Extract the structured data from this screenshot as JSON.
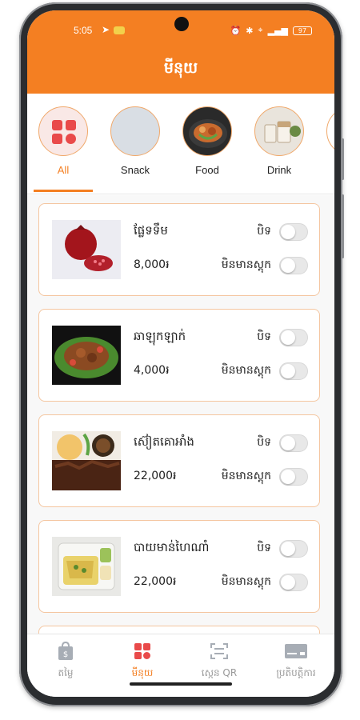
{
  "status": {
    "time": "5:05",
    "battery": "97"
  },
  "header": {
    "title": "មីនុយ"
  },
  "categories": [
    {
      "label": "All",
      "icon": "grid-icon"
    },
    {
      "label": "Snack",
      "icon": "snack-image"
    },
    {
      "label": "Food",
      "icon": "food-image"
    },
    {
      "label": "Drink",
      "icon": "drink-image"
    }
  ],
  "items": [
    {
      "name": "ផ្លែទទឹម",
      "price": "8,000៛",
      "close_label": "បិទ",
      "stock_label": "មិនមានស្តុក"
    },
    {
      "name": "ឆាឡុកឡាក់",
      "price": "4,000៛",
      "close_label": "បិទ",
      "stock_label": "មិនមានស្តុក"
    },
    {
      "name": "ស៊ៀតគោអាំង",
      "price": "22,000៛",
      "close_label": "បិទ",
      "stock_label": "មិនមានស្តុក"
    },
    {
      "name": "បាយមាន់ហៃណាំ",
      "price": "22,000៛",
      "close_label": "បិទ",
      "stock_label": "មិនមានស្តុក"
    }
  ],
  "nav": [
    {
      "label": "តម្លៃ",
      "icon": "shopping-bag-icon"
    },
    {
      "label": "មីនុយ",
      "icon": "menu-grid-icon"
    },
    {
      "label": "ស្កេន QR",
      "icon": "qr-scan-icon"
    },
    {
      "label": "ប្រតិបត្តិការ",
      "icon": "card-icon"
    }
  ],
  "colors": {
    "accent": "#f47f22",
    "border": "#f4c6a0"
  }
}
